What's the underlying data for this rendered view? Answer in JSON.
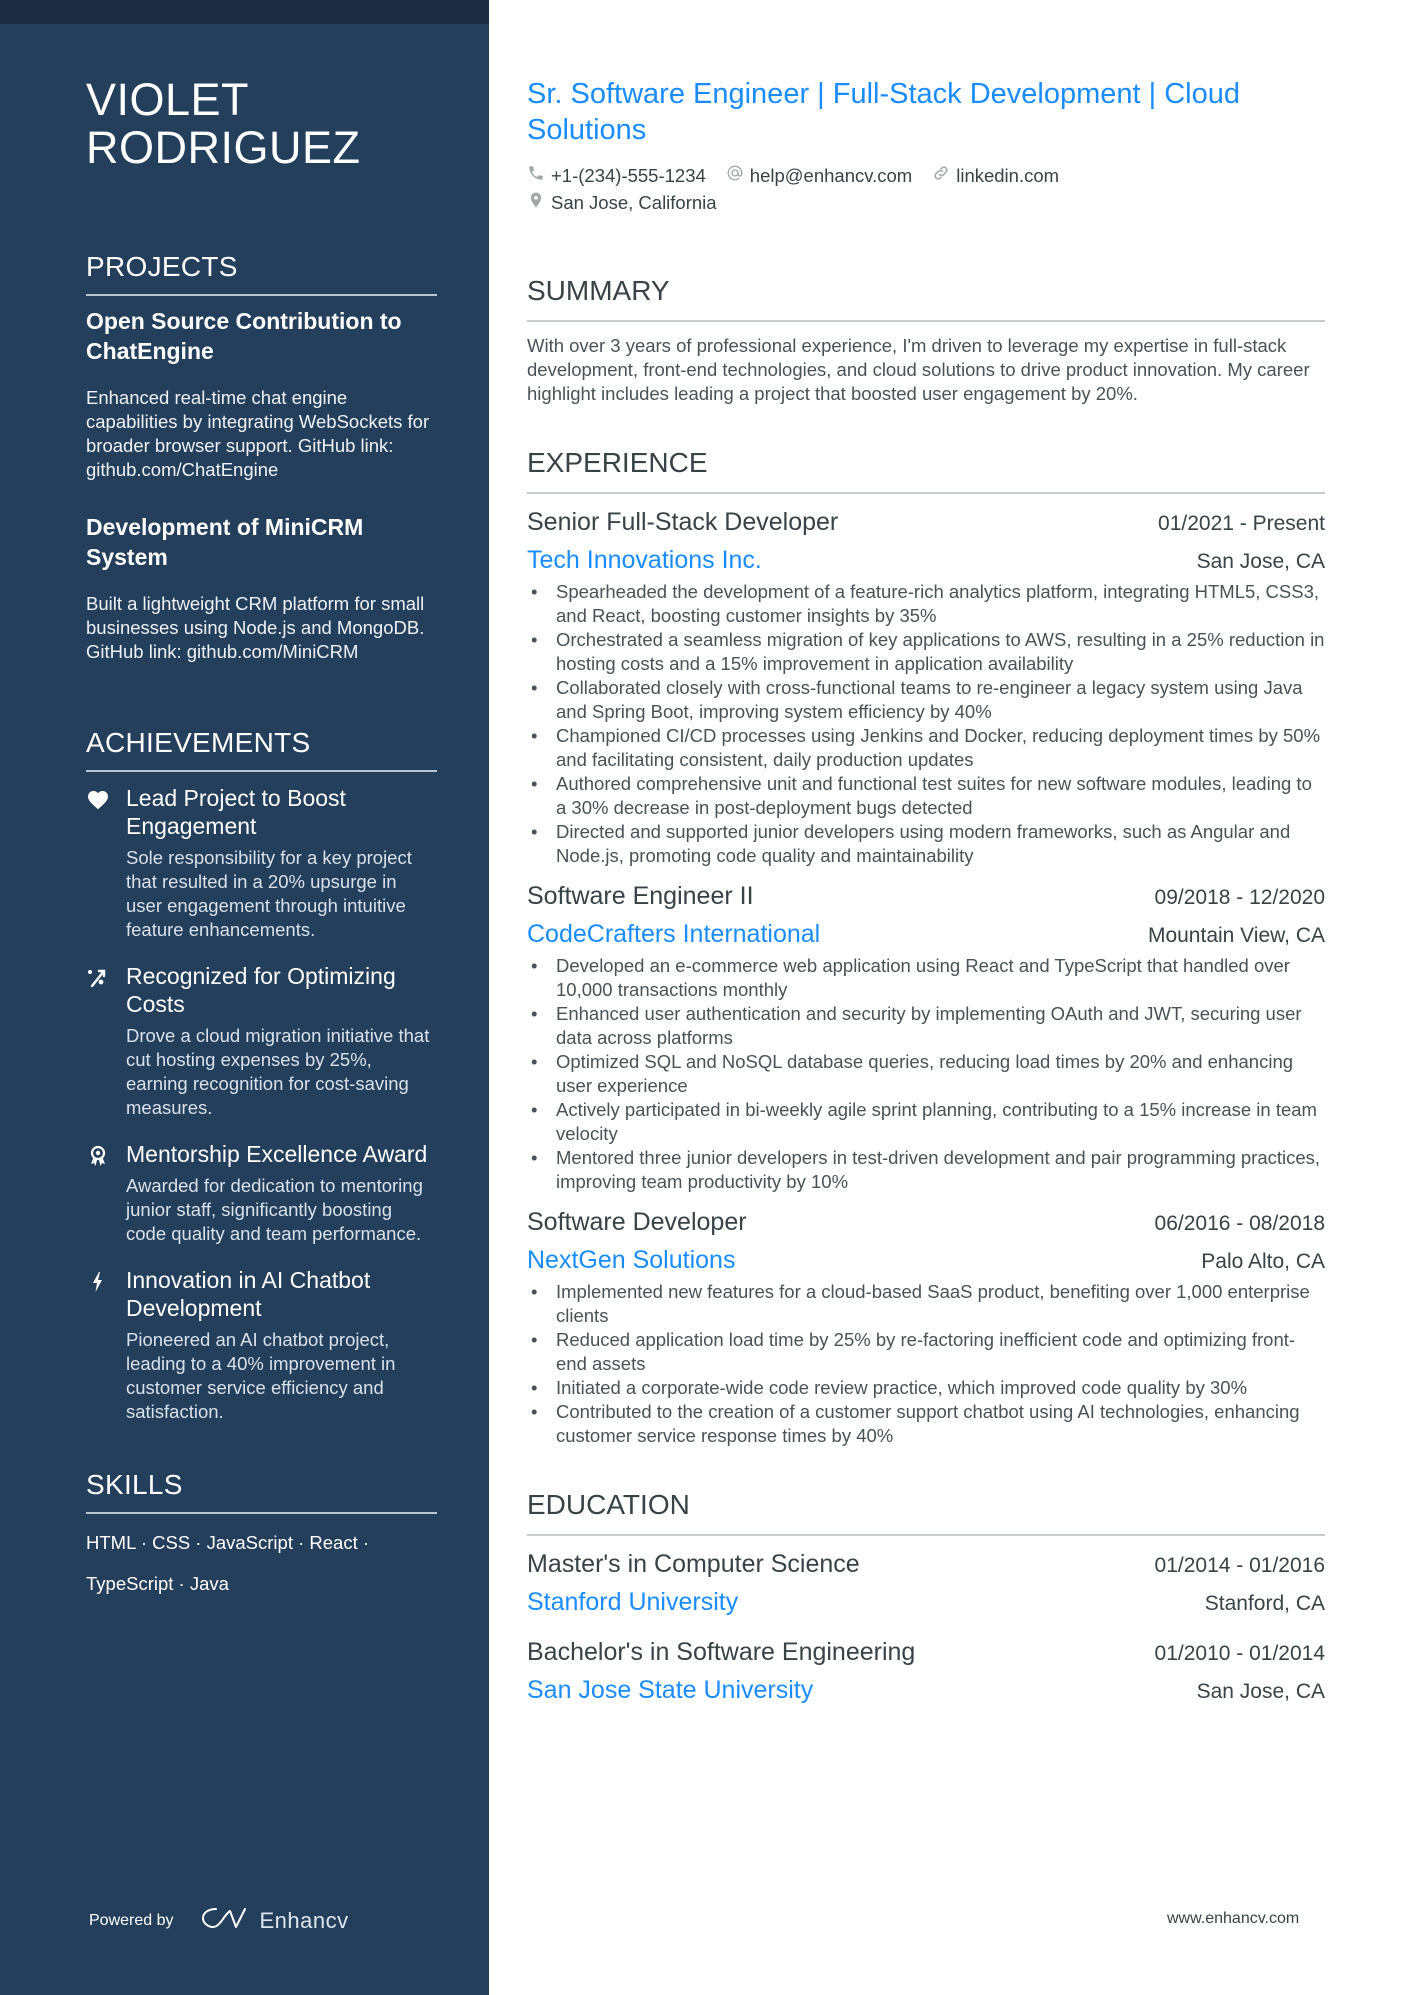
{
  "sidebar": {
    "name_line1": "VIOLET",
    "name_line2": "RODRIGUEZ",
    "projects": {
      "title": "PROJECTS",
      "items": [
        {
          "title": "Open Source Contribution to ChatEngine",
          "description": "Enhanced real-time chat engine capabilities by integrating WebSockets for broader browser support. GitHub link: github.com/ChatEngine"
        },
        {
          "title": "Development of MiniCRM System",
          "description": "Built a lightweight CRM platform for small businesses using Node.js and MongoDB. GitHub link: github.com/MiniCRM"
        }
      ]
    },
    "achievements": {
      "title": "ACHIEVEMENTS",
      "items": [
        {
          "icon": "heart-icon",
          "title": "Lead Project to Boost Engagement",
          "description": "Sole responsibility for a key project that resulted in a 20% upsurge in user engagement through intuitive feature enhancements."
        },
        {
          "icon": "percent-arrow-icon",
          "title": "Recognized for Optimizing Costs",
          "description": "Drove a cloud migration initiative that cut hosting expenses by 25%, earning recognition for cost-saving measures."
        },
        {
          "icon": "award-ribbon-icon",
          "title": "Mentorship Excellence Award",
          "description": "Awarded for dedication to mentoring junior staff, significantly boosting code quality and team performance."
        },
        {
          "icon": "lightning-bolt-icon",
          "title": "Innovation in AI Chatbot Development",
          "description": "Pioneered an AI chatbot project, leading to a 40% improvement in customer service efficiency and satisfaction."
        }
      ]
    },
    "skills": {
      "title": "SKILLS",
      "line1": "HTML · CSS · JavaScript · React ·",
      "line2": "TypeScript · Java"
    },
    "footer": {
      "powered_by": "Powered by",
      "brand": "Enhancv"
    }
  },
  "header": {
    "headline": "Sr. Software Engineer | Full-Stack Development | Cloud Solutions",
    "phone": "+1-(234)-555-1234",
    "email": "help@enhancv.com",
    "linkedin": "linkedin.com",
    "location": "San Jose, California"
  },
  "summary": {
    "title": "SUMMARY",
    "text": "With over 3 years of professional experience, I'm driven to leverage my expertise in full-stack development, front-end technologies, and cloud solutions to drive product innovation. My career highlight includes leading a project that boosted user engagement by 20%."
  },
  "experience": {
    "title": "EXPERIENCE",
    "jobs": [
      {
        "title": "Senior Full-Stack Developer",
        "dates": "01/2021 - Present",
        "company": "Tech Innovations Inc.",
        "location": "San Jose, CA",
        "bullets": [
          "Spearheaded the development of a feature-rich analytics platform, integrating HTML5, CSS3, and React, boosting customer insights by 35%",
          "Orchestrated a seamless migration of key applications to AWS, resulting in a 25% reduction in hosting costs and a 15% improvement in application availability",
          "Collaborated closely with cross-functional teams to re-engineer a legacy system using Java and Spring Boot, improving system efficiency by 40%",
          "Championed CI/CD processes using Jenkins and Docker, reducing deployment times by 50% and facilitating consistent, daily production updates",
          "Authored comprehensive unit and functional test suites for new software modules, leading to a 30% decrease in post-deployment bugs detected",
          "Directed and supported junior developers using modern frameworks, such as Angular and Node.js, promoting code quality and maintainability"
        ]
      },
      {
        "title": "Software Engineer II",
        "dates": "09/2018 - 12/2020",
        "company": "CodeCrafters International",
        "location": "Mountain View, CA",
        "bullets": [
          "Developed an e-commerce web application using React and TypeScript that handled over 10,000 transactions monthly",
          "Enhanced user authentication and security by implementing OAuth and JWT, securing user data across platforms",
          "Optimized SQL and NoSQL database queries, reducing load times by 20% and enhancing user experience",
          "Actively participated in bi-weekly agile sprint planning, contributing to a 15% increase in team velocity",
          "Mentored three junior developers in test-driven development and pair programming practices, improving team productivity by 10%"
        ]
      },
      {
        "title": "Software Developer",
        "dates": "06/2016 - 08/2018",
        "company": "NextGen Solutions",
        "location": "Palo Alto, CA",
        "bullets": [
          "Implemented new features for a cloud-based SaaS product, benefiting over 1,000 enterprise clients",
          "Reduced application load time by 25% by re-factoring inefficient code and optimizing front-end assets",
          "Initiated a corporate-wide code review practice, which improved code quality by 30%",
          "Contributed to the creation of a customer support chatbot using AI technologies, enhancing customer service response times by 40%"
        ]
      }
    ]
  },
  "education": {
    "title": "EDUCATION",
    "items": [
      {
        "degree": "Master's in Computer Science",
        "dates": "01/2014 - 01/2016",
        "school": "Stanford University",
        "location": "Stanford, CA"
      },
      {
        "degree": "Bachelor's in Software Engineering",
        "dates": "01/2010 - 01/2014",
        "school": "San Jose State University",
        "location": "San Jose, CA"
      }
    ]
  },
  "footer": {
    "website": "www.enhancv.com"
  },
  "colors": {
    "sidebar_bg": "#243f5c",
    "sidebar_topband": "#1b2c42",
    "accent": "#1a8cff",
    "text": "#384347"
  }
}
